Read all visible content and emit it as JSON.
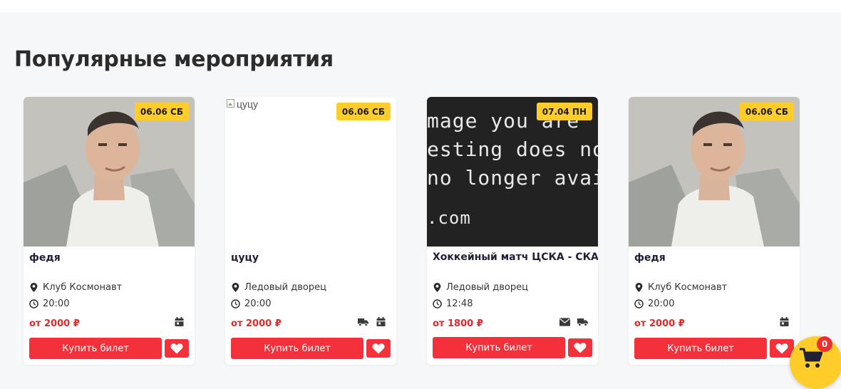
{
  "section": {
    "title": "Популярные мероприятия"
  },
  "cards": [
    {
      "image_alt": "",
      "image_kind": "portrait",
      "date": "06.06 СБ",
      "title": "федя",
      "place": "Клуб Космонавт",
      "time": "20:00",
      "price": "от 2000 ₽",
      "features": [
        "calendar-icon"
      ],
      "buy_label": "Купить билет"
    },
    {
      "image_alt": "цуцу",
      "image_kind": "broken",
      "date": "06.06 СБ",
      "title": "цуцу",
      "place": "Ледовый дворец",
      "time": "20:00",
      "price": "от 2000 ₽",
      "features": [
        "truck-icon",
        "calendar-icon"
      ],
      "buy_label": "Купить билет"
    },
    {
      "image_alt": "",
      "image_kind": "placeholder",
      "image_text": [
        "mage you are",
        "esting does not",
        "no longer availa",
        ".com"
      ],
      "date": "07.04 ПН",
      "title": "Хоккейный матч ЦСКА - СКА",
      "place": "Ледовый дворец",
      "time": "12:48",
      "price": "от 1800 ₽",
      "features": [
        "mail-icon",
        "truck-icon"
      ],
      "buy_label": "Купить билет"
    },
    {
      "image_alt": "",
      "image_kind": "portrait",
      "date": "06.06 СБ",
      "title": "федя",
      "place": "Клуб Космонавт",
      "time": "20:00",
      "price": "от 2000 ₽",
      "features": [
        "calendar-icon"
      ],
      "buy_label": "Купить билет"
    }
  ],
  "cart": {
    "count": "0"
  },
  "colors": {
    "accent": "#f4313a",
    "badge": "#ffcd2a",
    "price": "#e6272a"
  }
}
